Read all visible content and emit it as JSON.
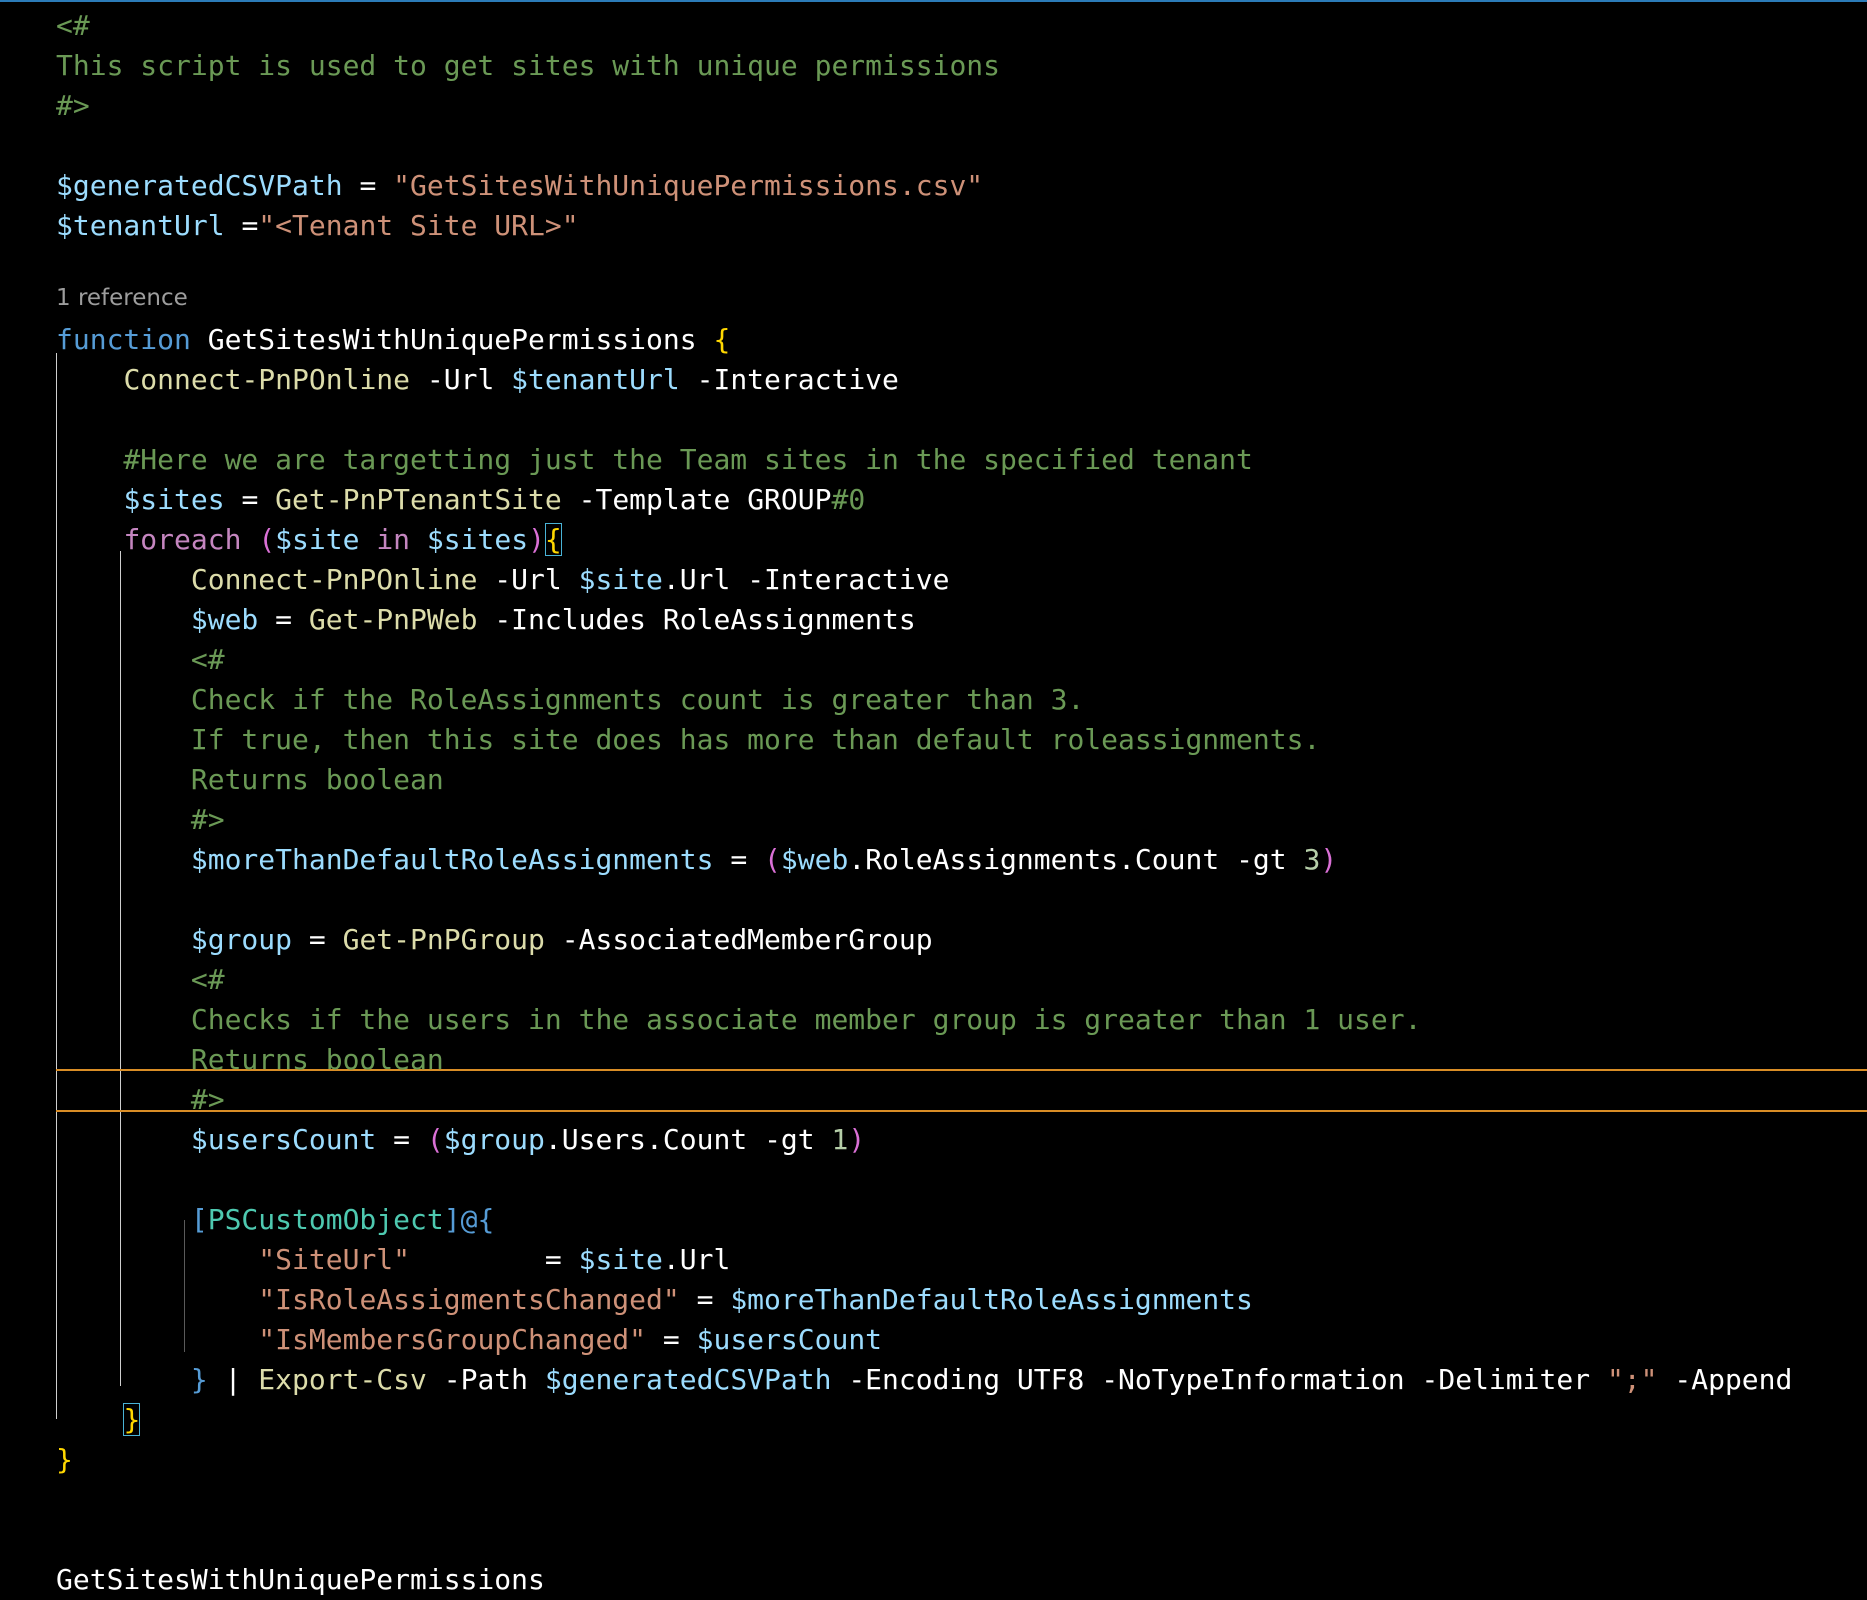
{
  "editor": {
    "codelens": "1 reference",
    "lines": [
      "<#",
      "This script is used to get sites with unique permissions",
      "#>",
      "",
      "$generatedCSVPath = \"GetSitesWithUniquePermissions.csv\"",
      "$tenantUrl =\"<Tenant Site URL>\"",
      "",
      "function GetSitesWithUniquePermissions {",
      "    Connect-PnPOnline -Url $tenantUrl -Interactive",
      "",
      "    #Here we are targetting just the Team sites in the specified tenant",
      "    $sites = Get-PnPTenantSite -Template GROUP#0",
      "    foreach ($site in $sites){",
      "        Connect-PnPOnline -Url $site.Url -Interactive",
      "        $web = Get-PnPWeb -Includes RoleAssignments",
      "        <#",
      "        Check if the RoleAssignments count is greater than 3.",
      "        If true, then this site does has more than default roleassignments.",
      "        Returns boolean",
      "        #>",
      "        $moreThanDefaultRoleAssignments = ($web.RoleAssignments.Count -gt 3)",
      "",
      "        $group = Get-PnPGroup -AssociatedMemberGroup",
      "        <#",
      "        Checks if the users in the associate member group is greater than 1 user.",
      "        Returns boolean",
      "        #>",
      "        $usersCount = ($group.Users.Count -gt 1)",
      "",
      "        [PSCustomObject]@{",
      "            \"SiteUrl\"        = $site.Url",
      "            \"IsRoleAssigmentsChanged\" = $moreThanDefaultRoleAssignments",
      "            \"IsMembersGroupChanged\" = $usersCount",
      "        } | Export-Csv -Path $generatedCSVPath -Encoding UTF8 -NoTypeInformation -Delimiter \";\" -Append",
      "    }",
      "}",
      "",
      "",
      "GetSitesWithUniquePermissions"
    ]
  }
}
